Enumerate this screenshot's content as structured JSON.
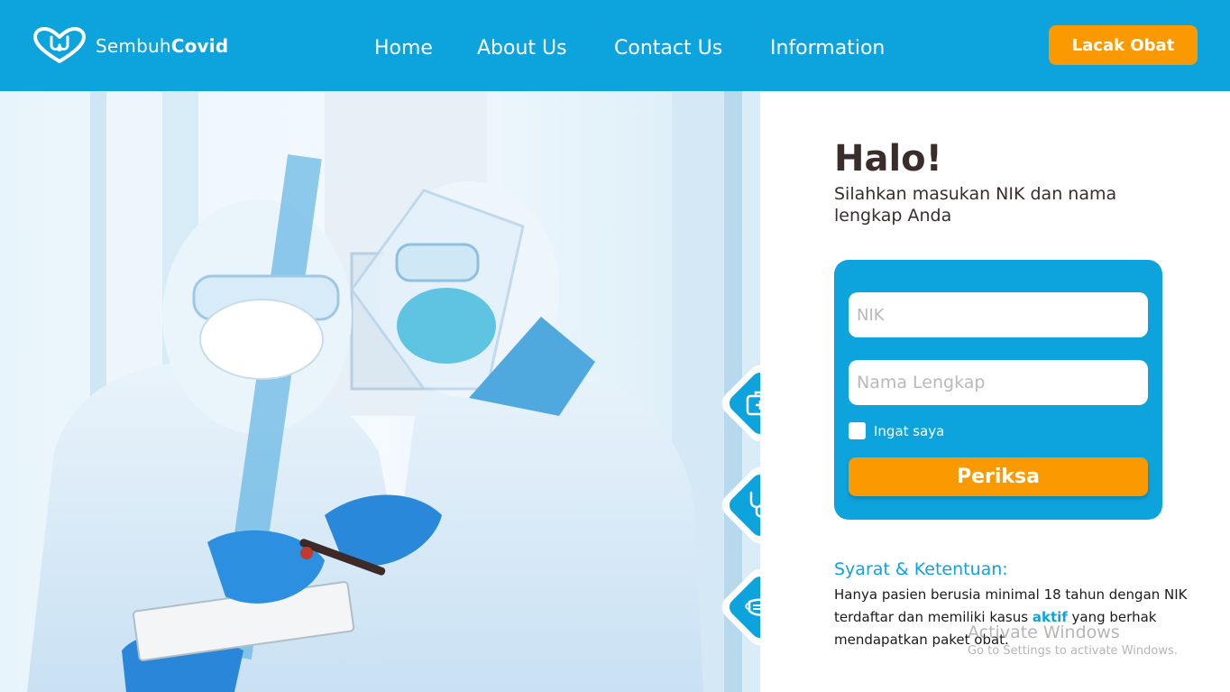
{
  "brand": {
    "name_light": "Sembuh",
    "name_bold": "Covid",
    "logo_icon": "heart-stethoscope-icon"
  },
  "nav": {
    "items": [
      {
        "label": "Home"
      },
      {
        "label": "About Us"
      },
      {
        "label": "Contact Us"
      },
      {
        "label": "Information"
      }
    ],
    "cta_label": "Lacak Obat"
  },
  "hero": {
    "image_subject": "two-health-workers-in-ppe",
    "side_icons": [
      "medical-kit-icon",
      "stethoscope-icon",
      "face-mask-icon"
    ]
  },
  "form": {
    "greeting": "Halo!",
    "subtitle": "Silahkan masukan NIK dan nama lengkap Anda",
    "nik_placeholder": "NIK",
    "nama_placeholder": "Nama Lengkap",
    "remember_label": "Ingat saya",
    "submit_label": "Periksa"
  },
  "terms": {
    "title": "Syarat & Ketentuan:",
    "text_before": "Hanya pasien berusia minimal 18 tahun dengan NIK terdaftar dan memiliki kasus ",
    "highlight": "aktif",
    "text_after": " yang berhak mendapatkan paket obat."
  },
  "os_watermark": {
    "title": "Activate Windows",
    "subtitle": "Go to Settings to activate Windows."
  },
  "colors": {
    "primary": "#0da3dc",
    "accent": "#fb9a00",
    "heading": "#3a2d2c",
    "text": "#1a1a1a",
    "white": "#ffffff"
  }
}
